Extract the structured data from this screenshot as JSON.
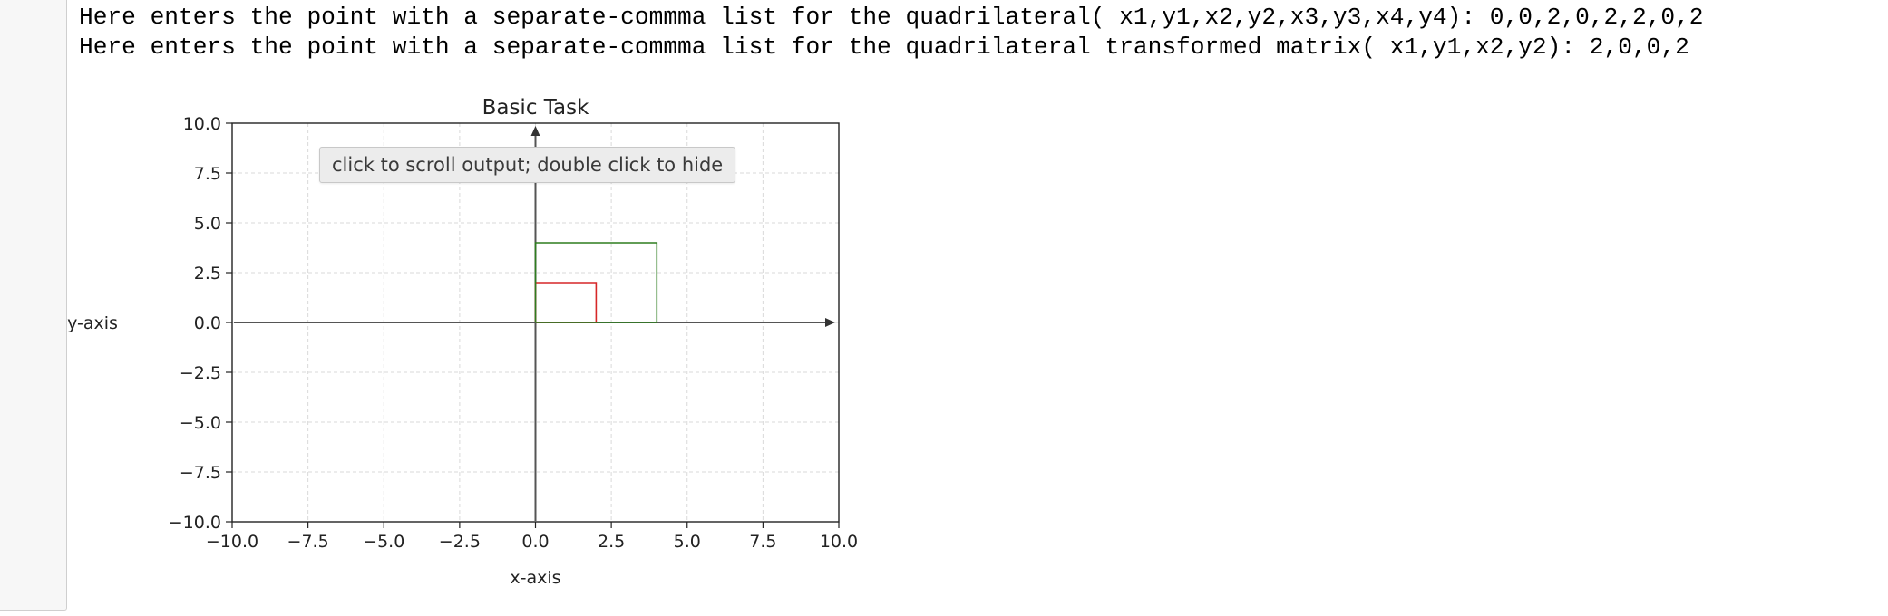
{
  "notebook": {
    "output_lines": [
      "Here enters the point with a separate-commma list for the quadrilateral( x1,y1,x2,y2,x3,y3,x4,y4): 0,0,2,0,2,2,0,2",
      "Here enters the point with a separate-commma list for the quadrilateral transformed matrix( x1,y1,x2,y2): 2,0,0,2"
    ],
    "output_tooltip": "click to scroll output; double click to hide"
  },
  "chart_data": {
    "type": "line",
    "title": "Basic Task",
    "xlabel": "x-axis",
    "ylabel": "y-axis",
    "xlim": [
      -10,
      10
    ],
    "ylim": [
      -10,
      10
    ],
    "xticks": [
      -10,
      -7.5,
      -5,
      -2.5,
      0,
      2.5,
      5,
      7.5,
      10
    ],
    "yticks": [
      -10,
      -7.5,
      -5,
      -2.5,
      0,
      2.5,
      5,
      7.5,
      10
    ],
    "xtick_labels": [
      "−10.0",
      "−7.5",
      "−5.0",
      "−2.5",
      "0.0",
      "2.5",
      "5.0",
      "7.5",
      "10.0"
    ],
    "ytick_labels": [
      "−10.0",
      "−7.5",
      "−5.0",
      "−2.5",
      "0.0",
      "2.5",
      "5.0",
      "7.5",
      "10.0"
    ],
    "grid": true,
    "axes_arrows": true,
    "series": [
      {
        "color": "#d62728",
        "x": [
          0,
          2,
          2,
          0,
          0
        ],
        "y": [
          0,
          0,
          2,
          2,
          0
        ]
      },
      {
        "color": "#2e7d1f",
        "x": [
          0,
          4,
          4,
          0,
          0
        ],
        "y": [
          0,
          0,
          4,
          4,
          0
        ]
      }
    ]
  }
}
